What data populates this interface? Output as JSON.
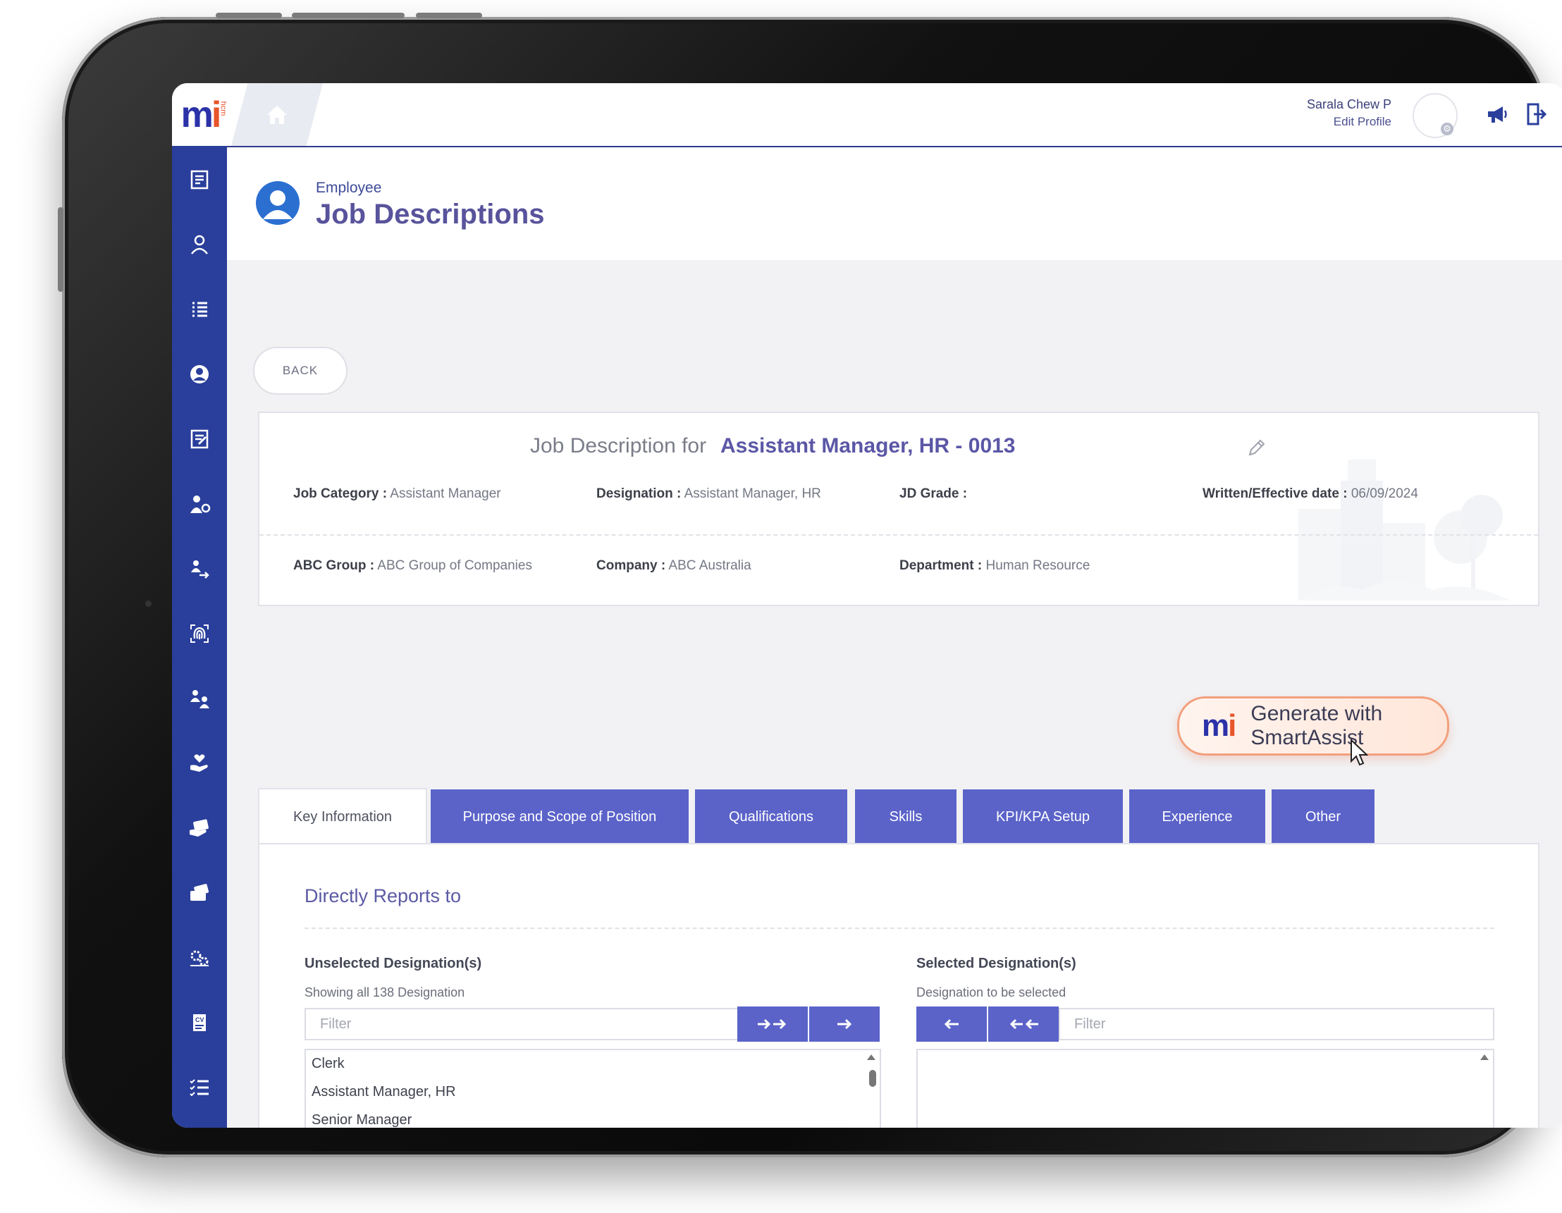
{
  "user": {
    "name": "Sarala Chew P",
    "edit_profile": "Edit Profile"
  },
  "header": {
    "breadcrumb": "Employee",
    "title": "Job Descriptions"
  },
  "back_label": "BACK",
  "job": {
    "prefix": "Job Description for",
    "name": "Assistant Manager, HR - 0013",
    "fields": [
      {
        "label": "Job Category :",
        "value": "Assistant Manager"
      },
      {
        "label": "Designation :",
        "value": "Assistant Manager, HR"
      },
      {
        "label": "JD Grade :",
        "value": ""
      },
      {
        "label": "Written/Effective date :",
        "value": "06/09/2024"
      },
      {
        "label": "ABC Group :",
        "value": "ABC Group of Companies"
      },
      {
        "label": "Company :",
        "value": "ABC Australia"
      },
      {
        "label": "Department :",
        "value": "Human Resource"
      }
    ]
  },
  "smart_assist": {
    "label": "Generate with SmartAssist",
    "logo": "mi"
  },
  "tabs": [
    "Key Information",
    "Purpose and Scope of Position",
    "Qualifications",
    "Skills",
    "KPI/KPA Setup",
    "Experience",
    "Other"
  ],
  "reports_to": {
    "title": "Directly Reports to",
    "unselected": {
      "title": "Unselected Designation(s)",
      "subtitle": "Showing all 138 Designation",
      "filter_placeholder": "Filter",
      "items": [
        "Clerk",
        "Assistant Manager, HR",
        "Senior Manager"
      ]
    },
    "selected": {
      "title": "Selected Designation(s)",
      "subtitle": "Designation to be selected",
      "filter_placeholder": "Filter",
      "items": []
    }
  },
  "colors": {
    "sidebar": "#2a3f9b",
    "accent": "#5b63c9",
    "title": "#58539b",
    "smart_border": "#f2a07e"
  },
  "sidebar_icons": [
    "notes-icon",
    "person-search-icon",
    "list-icon",
    "user-circle-icon",
    "form-icon",
    "person-gear-icon",
    "people-transfer-icon",
    "fingerprint-icon",
    "people-swap-icon",
    "hand-heart-icon",
    "payment-icon",
    "wallet-card-icon",
    "gears-icon",
    "cv-icon",
    "checklist-icon"
  ]
}
